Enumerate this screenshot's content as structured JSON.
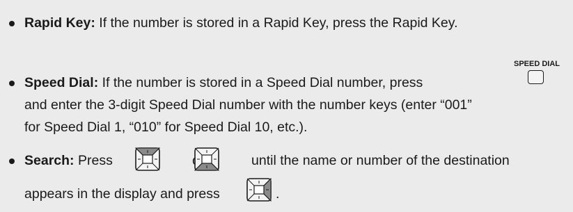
{
  "items": [
    {
      "term": "Rapid Key:",
      "lines": [
        "If the number is stored in a Rapid Key, press the Rapid Key."
      ]
    },
    {
      "term": "Speed Dial:",
      "lines": [
        "If the number is stored in a Speed Dial number, press",
        "and enter the 3-digit Speed Dial number with the number keys (enter “001”",
        "for Speed Dial 1, “010” for Speed Dial 10, etc.)."
      ],
      "key_label": "SPEED DIAL"
    },
    {
      "term": "Search:",
      "press": "Press",
      "or": "or",
      "rest": "until the name or number of the destination",
      "line2": "appears in the display and press",
      "end": "."
    }
  ],
  "icons": [
    "bullet",
    "speed-dial-key",
    "nav-up-key",
    "nav-down-key",
    "nav-right-key"
  ]
}
